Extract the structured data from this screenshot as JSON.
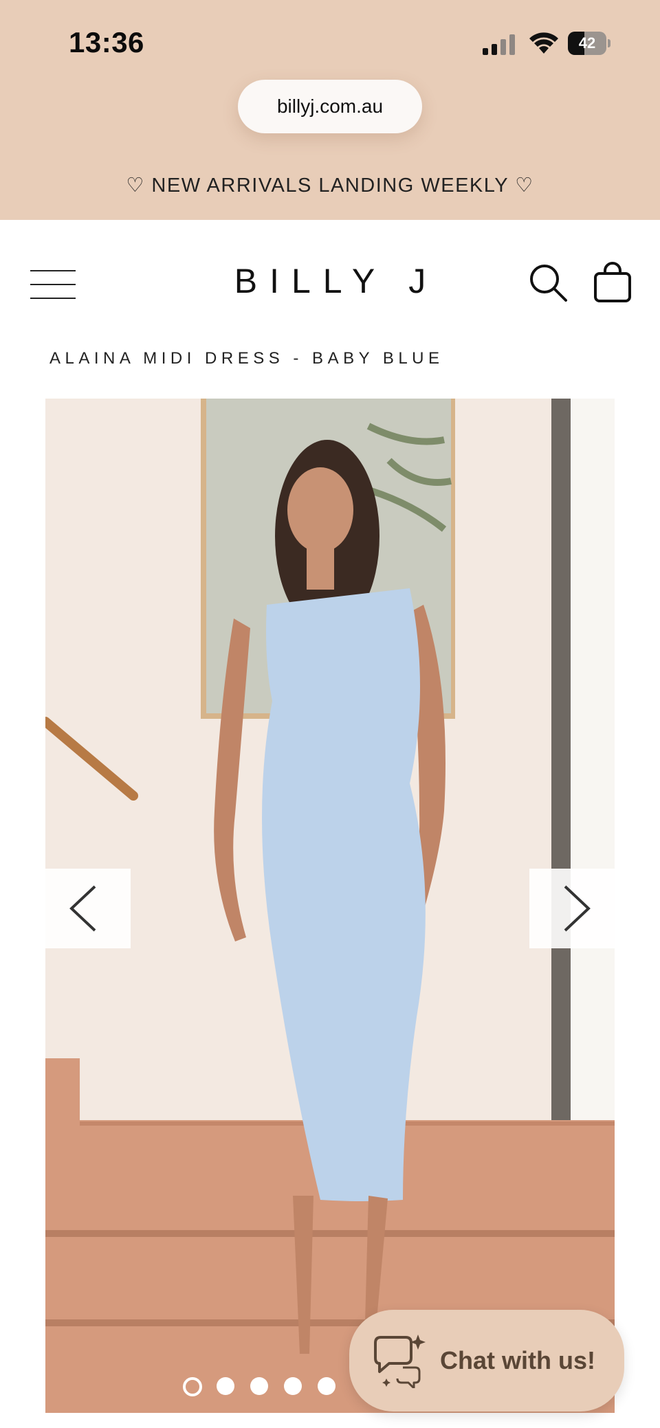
{
  "status_bar": {
    "time": "13:36",
    "battery_level": "42",
    "battery_fraction": 0.42,
    "icons": [
      "cellular-signal-icon",
      "wifi-icon",
      "battery-icon"
    ]
  },
  "browser": {
    "url": "billyj.com.au"
  },
  "announcement": {
    "text": "♡ NEW ARRIVALS LANDING WEEKLY ♡"
  },
  "header": {
    "logo": "BILLY J",
    "icons": [
      "menu-icon",
      "search-icon",
      "shopping-bag-icon"
    ]
  },
  "product": {
    "title": "ALAINA MIDI DRESS - BABY BLUE"
  },
  "gallery": {
    "image_count": 5,
    "active_index": 0,
    "prev_icon": "chevron-left-icon",
    "next_icon": "chevron-right-icon"
  },
  "chat": {
    "label": "Chat with us!",
    "icon": "chat-bubbles-icon"
  },
  "colors": {
    "top_background": "#e8cdb8",
    "chat_text": "#5a4636",
    "dress": "#bcd2ea"
  }
}
